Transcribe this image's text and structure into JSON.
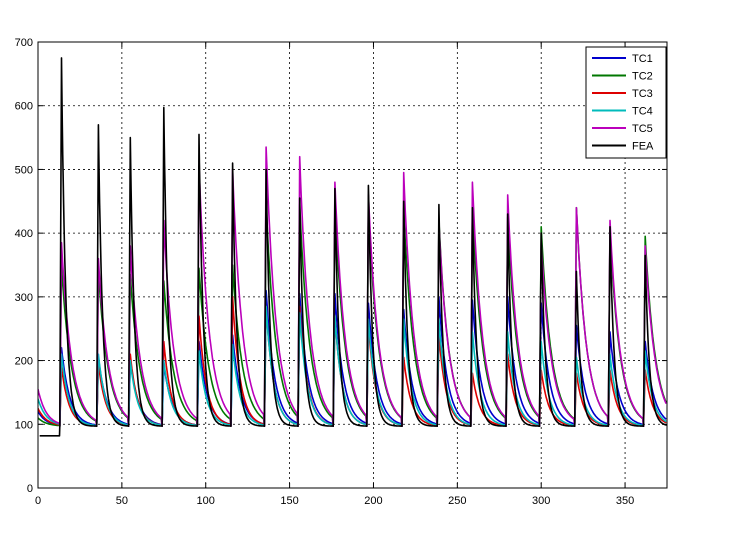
{
  "chart_data": {
    "type": "line",
    "title": "",
    "xlabel": "",
    "ylabel": "",
    "xlim": [
      0,
      375
    ],
    "ylim": [
      0,
      700
    ],
    "xticks": [
      0,
      50,
      100,
      150,
      200,
      250,
      300,
      350
    ],
    "yticks": [
      0,
      100,
      200,
      300,
      400,
      500,
      600,
      700
    ],
    "grid": true,
    "grid_style": "dotted",
    "legend_position": "top-right",
    "baseline": 97,
    "cycle_starts": [
      13,
      35,
      54,
      74,
      95,
      115,
      135,
      155,
      176,
      196,
      217,
      238,
      258,
      279,
      299,
      320,
      340,
      361
    ],
    "series": [
      {
        "name": "TC1",
        "color": "#0000cc",
        "peaks": [
          220,
          205,
          200,
          195,
          230,
          240,
          310,
          305,
          305,
          290,
          280,
          300,
          295,
          300,
          290,
          255,
          245,
          230
        ]
      },
      {
        "name": "TC2",
        "color": "#007700",
        "peaks": [
          350,
          340,
          335,
          325,
          345,
          350,
          445,
          445,
          445,
          440,
          440,
          420,
          440,
          425,
          410,
          440,
          405,
          395
        ]
      },
      {
        "name": "TC3",
        "color": "#dd0000",
        "peaks": [
          190,
          195,
          210,
          230,
          270,
          300,
          285,
          285,
          270,
          255,
          205,
          240,
          180,
          210,
          185,
          180,
          185,
          185
        ]
      },
      {
        "name": "TC4",
        "color": "#00bbbb",
        "peaks": [
          210,
          210,
          200,
          200,
          215,
          225,
          285,
          275,
          270,
          265,
          265,
          265,
          245,
          245,
          230,
          205,
          210,
          215
        ]
      },
      {
        "name": "TC5",
        "color": "#bb00bb",
        "peaks": [
          385,
          360,
          380,
          420,
          505,
          500,
          535,
          520,
          480,
          460,
          495,
          415,
          480,
          460,
          385,
          440,
          420,
          380
        ]
      },
      {
        "name": "FEA",
        "color": "#000000",
        "peaks": [
          675,
          570,
          550,
          597,
          555,
          510,
          500,
          455,
          470,
          475,
          450,
          445,
          440,
          430,
          400,
          340,
          410,
          365
        ]
      }
    ]
  }
}
